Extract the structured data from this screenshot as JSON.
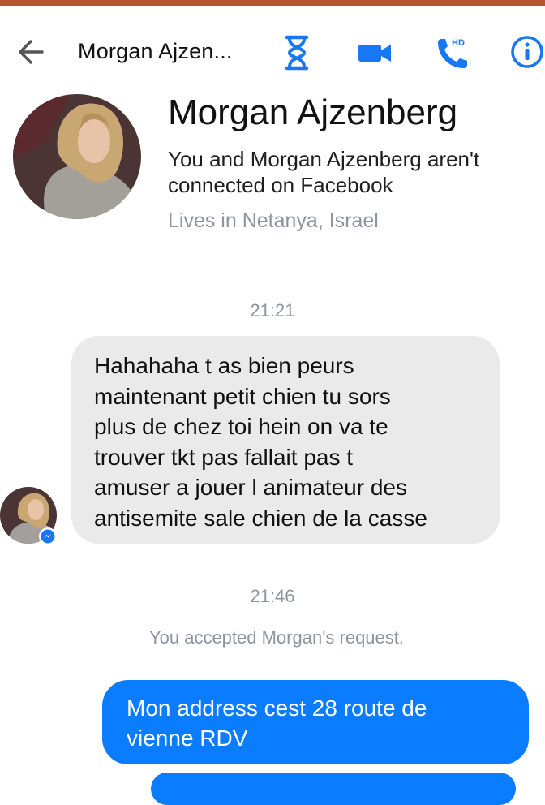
{
  "header": {
    "title": "Morgan Ajzen...",
    "icons": [
      "back-arrow-icon",
      "hourglass-icon",
      "video-camera-icon",
      "hd-phone-icon",
      "info-icon"
    ],
    "hd_badge": "HD",
    "accent_color": "#0a7cff"
  },
  "profile": {
    "name": "Morgan Ajzenberg",
    "connection": "You and Morgan Ajzenberg aren't connected on Facebook",
    "location": "Lives in Netanya, Israel"
  },
  "thread": {
    "time_1": "21:21",
    "incoming_message": "Hahahaha t as bien peurs\nmaintenant petit chien tu sors\nplus de chez toi hein on va te\ntrouver tkt pas fallait pas t\namuser a jouer l animateur des\nantisemite sale chien de la casse",
    "time_2": "21:46",
    "system_message": "You accepted Morgan's request.",
    "outgoing_message": "Mon address cest 28 route de\nvienne RDV"
  },
  "colors": {
    "incoming_bubble": "#eaeaea",
    "outgoing_bubble": "#0a7cff",
    "meta_text": "#8d949e"
  }
}
